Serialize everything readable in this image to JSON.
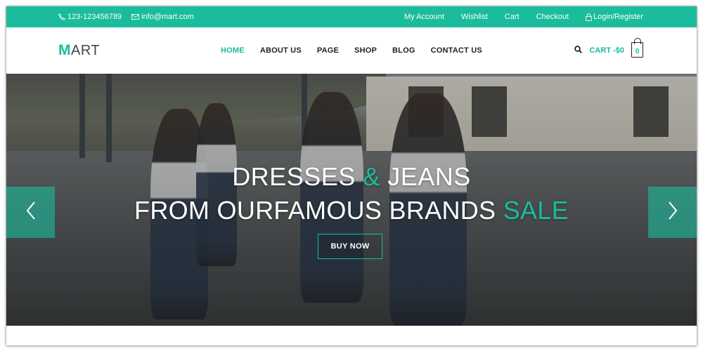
{
  "colors": {
    "accent": "#1abc9c",
    "text_dark": "#222222",
    "white": "#ffffff"
  },
  "topbar": {
    "phone": "123-123456789",
    "email": "info@mart.com",
    "links": [
      "My Account",
      "Wishlist",
      "Cart",
      "Checkout"
    ],
    "login": "Login/Register"
  },
  "header": {
    "logo_first": "M",
    "logo_rest": "ART",
    "nav": [
      "HOME",
      "ABOUT US",
      "PAGE",
      "SHOP",
      "BLOG",
      "CONTACT US"
    ],
    "active_nav": "HOME",
    "cart_label": "CART -$0",
    "cart_count": "0"
  },
  "hero": {
    "line1_a": "DRESSES ",
    "line1_amp": "&",
    "line1_b": " JEANS",
    "line2_a": "FROM OURFAMOUS BRANDS ",
    "line2_sale": "SALE",
    "button": "BUY NOW"
  },
  "icons": {
    "phone": "phone-icon",
    "email": "envelope-icon",
    "lock": "lock-icon",
    "search": "search-icon",
    "bag": "shopping-bag-icon",
    "prev": "chevron-left-icon",
    "next": "chevron-right-icon"
  }
}
